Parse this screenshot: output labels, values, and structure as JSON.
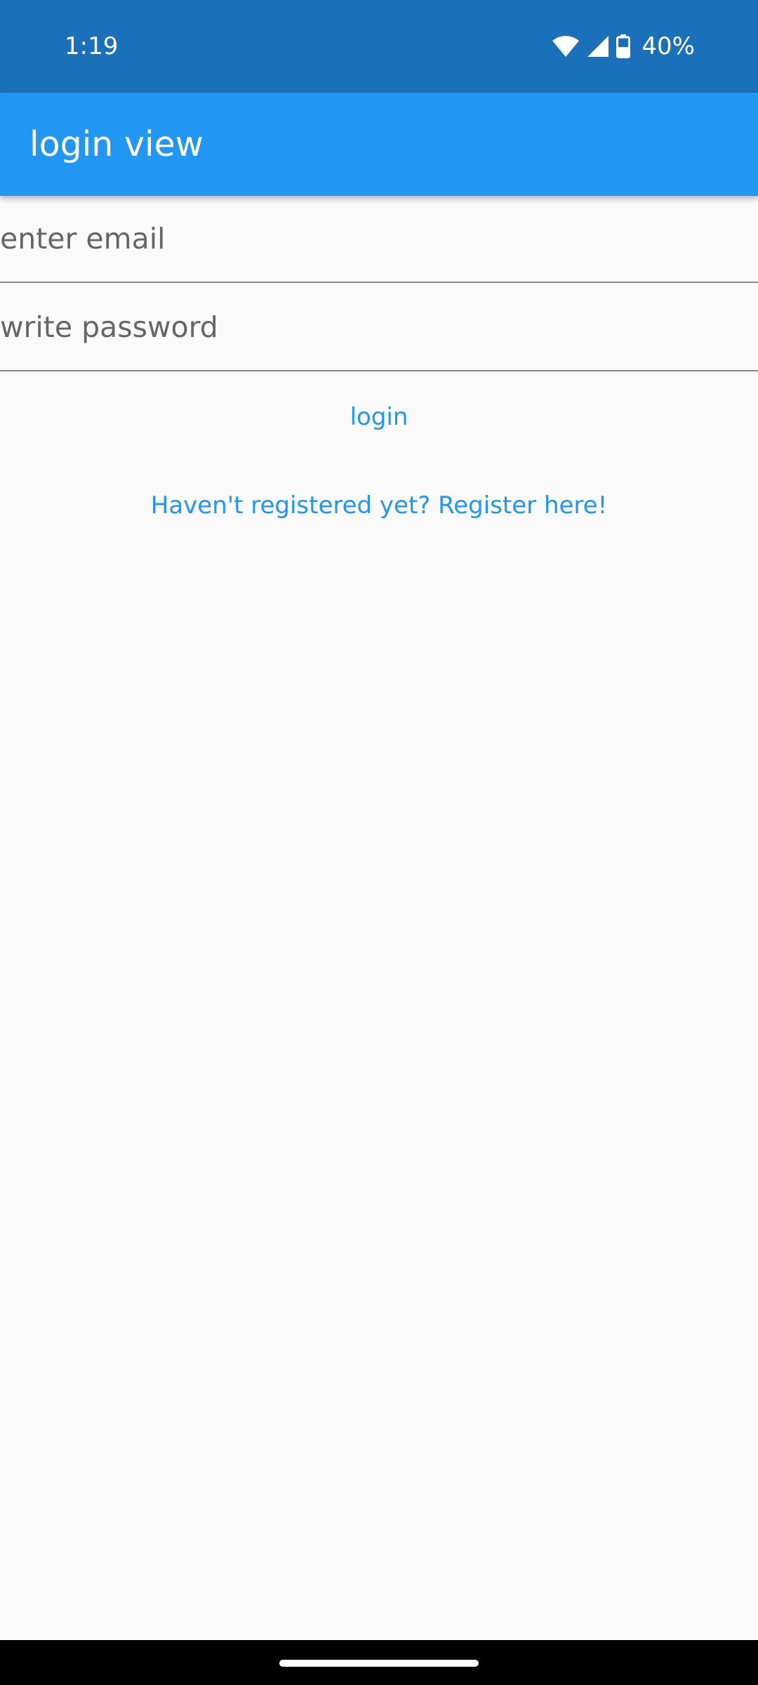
{
  "status_bar": {
    "time": "1:19",
    "battery": "40%",
    "icons": [
      "wifi-icon",
      "cellular-signal-icon",
      "battery-icon"
    ]
  },
  "app_bar": {
    "title": "login view",
    "color": "#2196f3"
  },
  "form": {
    "email_placeholder": "enter email",
    "email_value": "",
    "password_placeholder": "write password",
    "password_value": ""
  },
  "actions": {
    "login_label": "login",
    "register_label": "Haven't registered yet? Register here!"
  },
  "colors": {
    "status_bar": "#1b71b9",
    "accent": "#2196f3",
    "background": "#fafafa"
  }
}
